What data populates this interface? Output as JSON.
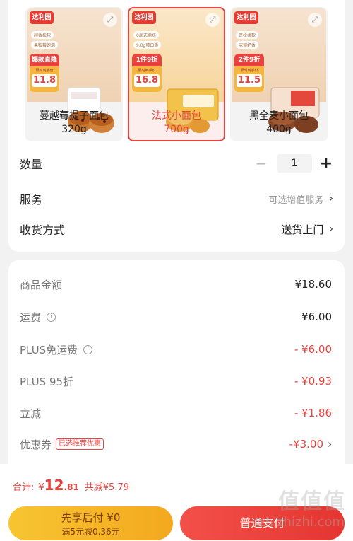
{
  "variants": [
    {
      "brand": "达利园",
      "tag1": "超香松软",
      "tag2": "果粒莓饱满",
      "promo_title": "爆款直降",
      "promo_sub": "限时到手价",
      "promo_price": "11.8",
      "name": "蔓越莓提子面包",
      "weight": "320g",
      "selected": false
    },
    {
      "brand": "达利园",
      "tag1": "0反式脂肪",
      "tag2": "9.0g蛋白质",
      "promo_title": "1件9折",
      "promo_sub": "限时到手价",
      "promo_price": "16.8",
      "name": "法式小面包",
      "weight": "700g",
      "selected": true
    },
    {
      "brand": "达利园",
      "tag1": "蓬松柔软",
      "tag2": "浓郁奶香",
      "promo_title": "2件9折",
      "promo_sub": "限时到手价",
      "promo_price": "11.5",
      "name": "黑全麦小面包",
      "weight": "400g",
      "selected": false
    }
  ],
  "quantity": {
    "label": "数量",
    "value": "1",
    "minus": "−",
    "plus": "+"
  },
  "service": {
    "label": "服务",
    "value": "可选增值服务",
    "chev": "›"
  },
  "delivery": {
    "label": "收货方式",
    "value": "送货上门",
    "chev": "›"
  },
  "price_lines": [
    {
      "name": "商品金额",
      "value": "¥18.60",
      "info": false,
      "badge": "",
      "red": false,
      "chev": ""
    },
    {
      "name": "运费",
      "value": "¥6.00",
      "info": true,
      "badge": "",
      "red": false,
      "chev": ""
    },
    {
      "name": "PLUS免运费",
      "value": "- ¥6.00",
      "info": true,
      "badge": "",
      "red": true,
      "chev": ""
    },
    {
      "name": "PLUS 95折",
      "value": "- ¥0.93",
      "info": false,
      "badge": "",
      "red": true,
      "chev": ""
    },
    {
      "name": "立减",
      "value": "- ¥1.86",
      "info": false,
      "badge": "",
      "red": true,
      "chev": ""
    },
    {
      "name": "优惠券",
      "value": "-¥3.00",
      "info": false,
      "badge": "已选推荐优惠",
      "red": true,
      "chev": "›"
    }
  ],
  "info_glyph": "i",
  "total": {
    "label": "合计:",
    "currency": "¥",
    "int": "12",
    "dec": ".81",
    "saved": "共减¥5.79"
  },
  "buttons": {
    "pay_later_main": "先享后付 ¥0",
    "pay_later_sub": "满5元减0.36元",
    "normal": "普通支付"
  },
  "watermark": {
    "logo": "值值值",
    "url": "zhizhizhi.com"
  },
  "colors": {
    "accent": "#e8433e",
    "pay_later": "#f4a81e"
  }
}
